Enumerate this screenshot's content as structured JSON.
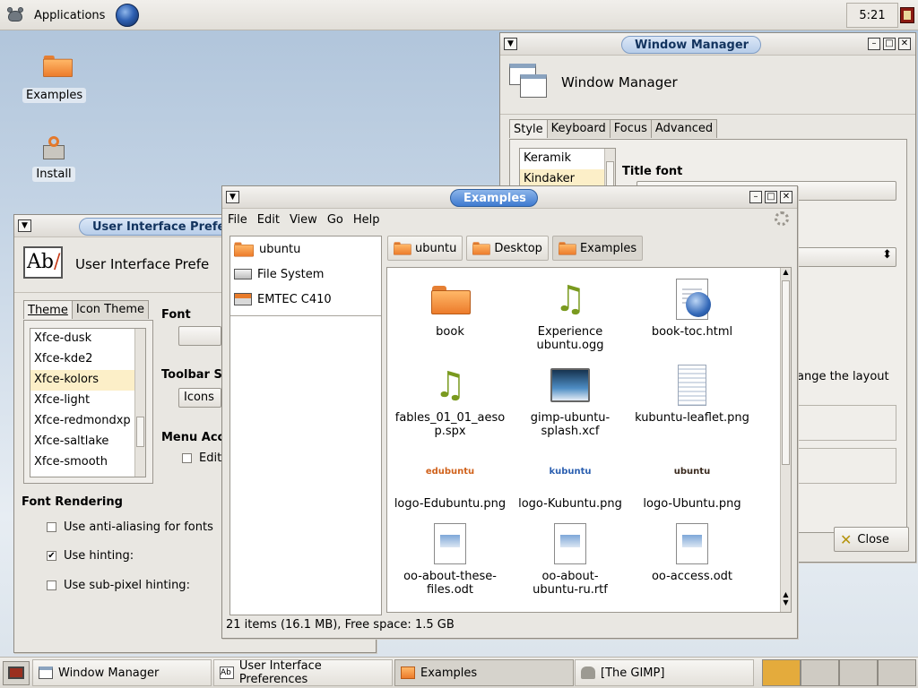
{
  "top_panel": {
    "applications_label": "Applications",
    "clock": "5:21"
  },
  "desktop_icons": [
    {
      "label": "Examples"
    },
    {
      "label": "Install"
    }
  ],
  "window_manager": {
    "title": "Window Manager",
    "header": "Window Manager",
    "tabs": [
      "Style",
      "Keyboard",
      "Focus",
      "Advanced"
    ],
    "themes": [
      "Keramik",
      "Kindaker"
    ],
    "title_font_label": "Title font",
    "layout_text": "ange the layout",
    "close_label": "Close"
  },
  "ui_prefs": {
    "title": "User Interface Prefe",
    "header": "User Interface Prefe",
    "tabs": [
      "Theme",
      "Icon Theme"
    ],
    "themes": [
      "Xfce-dusk",
      "Xfce-kde2",
      "Xfce-kolors",
      "Xfce-light",
      "Xfce-redmondxp",
      "Xfce-saltlake",
      "Xfce-smooth"
    ],
    "selected_theme": "Xfce-kolors",
    "font_label": "Font",
    "toolbar_label": "Toolbar St",
    "toolbar_value": "Icons",
    "menu_label": "Menu Acc",
    "menu_check": "Edita",
    "font_rendering_label": "Font Rendering",
    "checks": [
      {
        "label": "Use anti-aliasing for fonts",
        "checked": false
      },
      {
        "label": "Use hinting:",
        "checked": true
      },
      {
        "label": "Use sub-pixel hinting:",
        "checked": false
      }
    ]
  },
  "file_manager": {
    "title": "Examples",
    "menu": [
      "File",
      "Edit",
      "View",
      "Go",
      "Help"
    ],
    "sidebar": [
      "ubuntu",
      "File System",
      "EMTEC C410"
    ],
    "breadcrumbs": [
      "ubuntu",
      "Desktop",
      "Examples"
    ],
    "files": [
      {
        "name": "book",
        "icon": "folder-icon"
      },
      {
        "name": "Experience ubuntu.ogg",
        "icon": "audio-icon"
      },
      {
        "name": "book-toc.html",
        "icon": "html-icon"
      },
      {
        "name": "fables_01_01_aesop.spx",
        "icon": "audio-icon"
      },
      {
        "name": "gimp-ubuntu-splash.xcf",
        "icon": "image-icon"
      },
      {
        "name": "kubuntu-leaflet.png",
        "icon": "leaflet-icon"
      },
      {
        "name": "logo-Edubuntu.png",
        "icon": "logo-icon",
        "logo_text": "edubuntu"
      },
      {
        "name": "logo-Kubuntu.png",
        "icon": "logo-icon",
        "logo_text": "kubuntu"
      },
      {
        "name": "logo-Ubuntu.png",
        "icon": "logo-icon",
        "logo_text": "ubuntu"
      },
      {
        "name": "oo-about-these-files.odt",
        "icon": "doc-icon"
      },
      {
        "name": "oo-about-ubuntu-ru.rtf",
        "icon": "doc-icon"
      },
      {
        "name": "oo-access.odt",
        "icon": "doc-icon"
      }
    ],
    "status": "21 items (16.1 MB), Free space: 1.5 GB"
  },
  "taskbar": {
    "tasks": [
      "Window Manager",
      "User Interface Preferences",
      "Examples",
      "[The GIMP]"
    ]
  },
  "colors": {
    "accent": "#3f7ad0",
    "folder": "#ec7b2b",
    "selection": "#fcefc8",
    "audio": "#7a9a1f"
  }
}
